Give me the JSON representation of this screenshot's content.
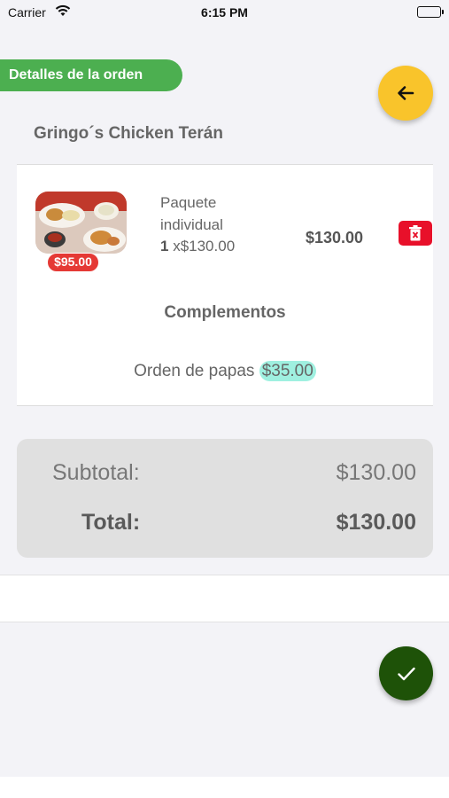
{
  "status_bar": {
    "carrier": "Carrier",
    "time": "6:15 PM"
  },
  "header": {
    "tag": "Detalles de la orden",
    "back_icon": "arrow-left-icon"
  },
  "store": {
    "name": "Gringo´s Chicken Terán"
  },
  "item": {
    "name": "Paquete individual",
    "quantity": "1",
    "unit_price": " x$130.00",
    "badge_price": "$95.00",
    "total": "$130.00",
    "delete_icon": "trash-icon"
  },
  "complements": {
    "title": "Complementos",
    "items": [
      {
        "name": "Orden de papas",
        "price": "$35.00"
      }
    ]
  },
  "summary": {
    "subtotal_label": "Subtotal:",
    "subtotal_value": "$130.00",
    "total_label": "Total:",
    "total_value": "$130.00"
  },
  "colors": {
    "tag_green": "#4caf50",
    "back_yellow": "#f9c42b",
    "confirm_green": "#1e5208",
    "delete_red": "#e8102a",
    "badge_red": "#e53935",
    "complement_highlight": "#9ff0e0"
  },
  "confirm_icon": "check-icon"
}
